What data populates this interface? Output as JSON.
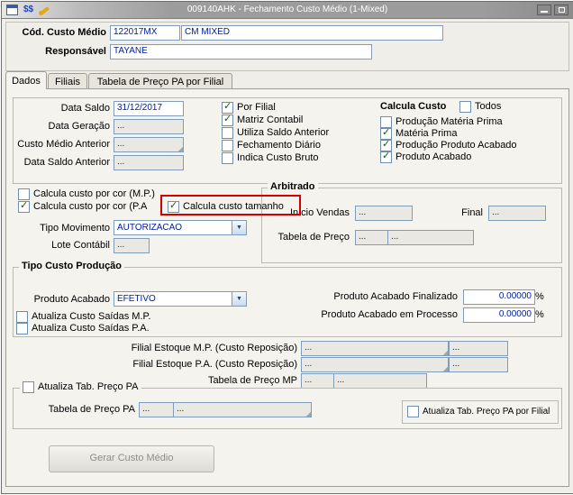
{
  "titlebar": {
    "title": "009140AHK - Fechamento Custo Médio (1-Mixed)",
    "icons": [
      "form-icon",
      "coins-icon",
      "wrench-icon"
    ]
  },
  "header": {
    "cod": {
      "label": "Cód. Custo Médio",
      "value": "122017MX",
      "desc": "CM MIXED"
    },
    "resp": {
      "label": "Responsável",
      "value": "TAYANE"
    }
  },
  "tabs": [
    {
      "label": "Dados"
    },
    {
      "label": "Filiais"
    },
    {
      "label": "Tabela de Preço PA por Filial"
    }
  ],
  "dates": {
    "data_saldo": {
      "label": "Data Saldo",
      "value": "31/12/2017"
    },
    "data_geracao": {
      "label": "Data Geração",
      "value": "..."
    },
    "custo_medio_anterior": {
      "label": "Custo Médio Anterior",
      "value": "..."
    },
    "data_saldo_anterior": {
      "label": "Data Saldo Anterior",
      "value": "..."
    }
  },
  "flags": {
    "por_filial": {
      "label": "Por Filial",
      "checked": true
    },
    "matriz_contabil": {
      "label": "Matriz Contabil",
      "checked": true
    },
    "utiliza_saldo_anterior": {
      "label": "Utiliza Saldo Anterior",
      "checked": false
    },
    "fechamento_diario": {
      "label": "Fechamento Diário",
      "checked": false
    },
    "indica_custo_bruto": {
      "label": "Indica Custo Bruto",
      "checked": false
    }
  },
  "calcula_custo": {
    "title": "Calcula Custo",
    "todos": {
      "label": "Todos",
      "checked": false
    },
    "producao_mp": {
      "label": "Produção Matéria Prima",
      "checked": false
    },
    "mp": {
      "label": "Matéria Prima",
      "checked": true
    },
    "producao_pa": {
      "label": "Produção Produto Acabado",
      "checked": true
    },
    "pa": {
      "label": "Produto Acabado",
      "checked": true
    }
  },
  "cor": {
    "mp": {
      "label": "Calcula custo por cor (M.P.)",
      "checked": false
    },
    "pa": {
      "label": "Calcula custo por cor (P.A",
      "checked": true
    },
    "tamanho": {
      "label": "Calcula custo tamanho",
      "checked": true
    }
  },
  "movimento": {
    "tipo": {
      "label": "Tipo Movimento",
      "value": "AUTORIZACAO"
    },
    "lote": {
      "label": "Lote Contábil",
      "value": "..."
    }
  },
  "arbitrado": {
    "title": "Arbitrado",
    "inicio": {
      "label": "Início Vendas",
      "value": "..."
    },
    "final": {
      "label": "Final",
      "value": "..."
    },
    "tabela": {
      "label": "Tabela de Preço",
      "value": "...",
      "value2": "..."
    }
  },
  "tipo_custo": {
    "title": "Tipo Custo Produção",
    "produto_acabado": {
      "label": "Produto Acabado",
      "value": "EFETIVO"
    },
    "atualiza_mp": {
      "label": "Atualiza Custo Saídas M.P.",
      "checked": false
    },
    "atualiza_pa": {
      "label": "Atualiza Custo Saídas P.A.",
      "checked": false
    },
    "finalizado": {
      "label": "Produto Acabado Finalizado",
      "value": "0.00000",
      "unit": "%"
    },
    "processo": {
      "label": "Produto Acabado em Processo",
      "value": "0.00000",
      "unit": "%"
    }
  },
  "filiais": [
    {
      "label": "Filial Estoque M.P. (Custo Reposição)",
      "value": "...",
      "value2": "..."
    },
    {
      "label": "Filial Estoque P.A. (Custo Reposição)",
      "value": "...",
      "value2": "..."
    },
    {
      "label": "Tabela de Preço MP",
      "value": "...",
      "value2": "..."
    }
  ],
  "atualiza": {
    "tab_pa": {
      "label": "Atualiza Tab. Preço PA",
      "checked": false
    },
    "tabela_pa": {
      "label": "Tabela de Preço PA",
      "value": "...",
      "value2": "..."
    },
    "por_filial": {
      "label": "Atualiza Tab. Preço PA por Filial",
      "checked": false
    }
  },
  "actions": {
    "gerar": "Gerar Custo Médio"
  }
}
